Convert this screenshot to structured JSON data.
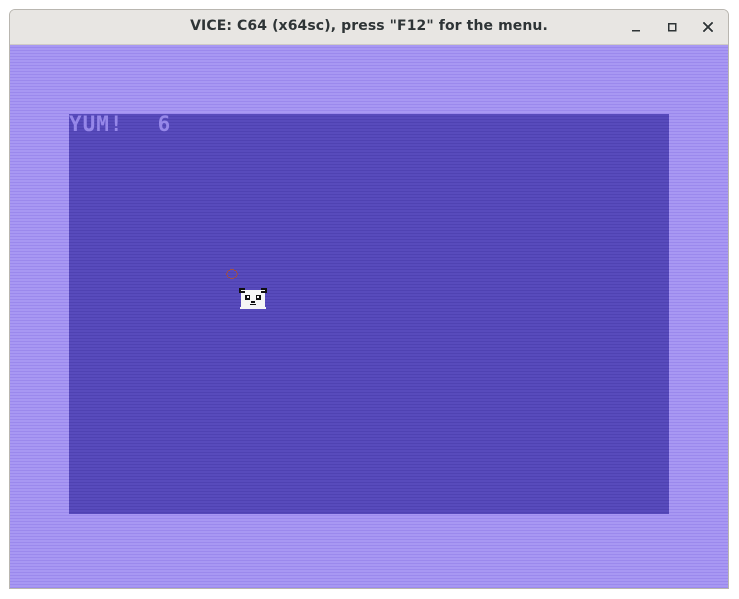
{
  "window": {
    "title": "VICE: C64 (x64sc), press \"F12\" for the menu.",
    "controls": {
      "minimize": "minimize-icon",
      "maximize": "maximize-icon",
      "close": "close-icon"
    }
  },
  "game": {
    "label": "YUM!",
    "score": "6"
  },
  "sprites": {
    "target_icon": "red-ring-icon",
    "player_icon": "panda-icon"
  },
  "colors": {
    "border": "#a898f3",
    "playfield": "#584bbc",
    "hud_text": "#9687e9",
    "target": "#9f4f43",
    "panda_white": "#f5f5f5",
    "panda_black": "#111111"
  }
}
